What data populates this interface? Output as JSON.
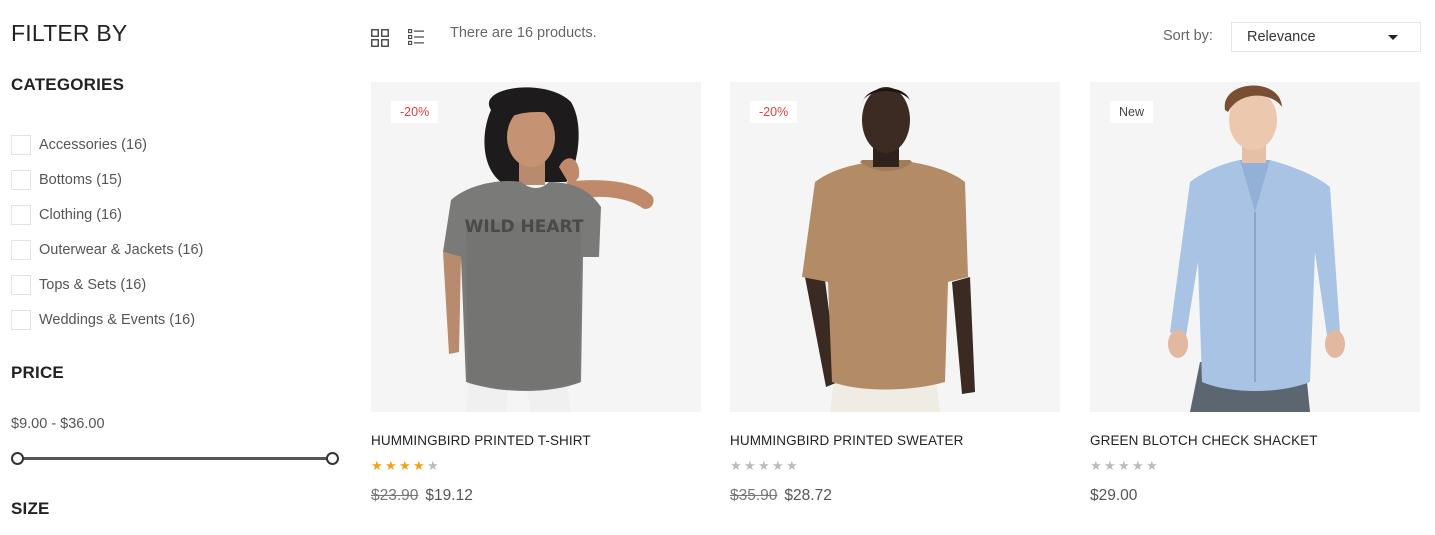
{
  "sidebar": {
    "title": "FILTER BY",
    "categories_title": "CATEGORIES",
    "categories": [
      {
        "label": "Accessories",
        "count": "(16)"
      },
      {
        "label": "Bottoms",
        "count": "(15)"
      },
      {
        "label": "Clothing",
        "count": "(16)"
      },
      {
        "label": "Outerwear & Jackets",
        "count": "(16)"
      },
      {
        "label": "Tops & Sets",
        "count": "(16)"
      },
      {
        "label": "Weddings & Events",
        "count": "(16)"
      }
    ],
    "price_title": "PRICE",
    "price_range": "$9.00 - $36.00",
    "size_title": "SIZE"
  },
  "toolbar": {
    "grid_icon": "grid-view-icon",
    "list_icon": "list-view-icon",
    "product_count": "There are 16 products.",
    "sort_label": "Sort by:",
    "sort_value": "Relevance"
  },
  "products": [
    {
      "badge": "-20%",
      "name": "HUMMINGBIRD PRINTED T-SHIRT",
      "rating": 4,
      "old_price": "$23.90",
      "price": "$19.12",
      "print_text": "WILD HEART"
    },
    {
      "badge": "-20%",
      "name": "HUMMINGBIRD PRINTED SWEATER",
      "rating": 0,
      "old_price": "$35.90",
      "price": "$28.72"
    },
    {
      "badge": "New",
      "name": "GREEN BLOTCH CHECK SHACKET",
      "rating": 0,
      "old_price": "",
      "price": "$29.00"
    }
  ],
  "colors": {
    "sale": "#e0413f",
    "star_on": "#f1a21a",
    "star_off": "#bbbbbb",
    "image_bg": "#f5f5f5"
  }
}
